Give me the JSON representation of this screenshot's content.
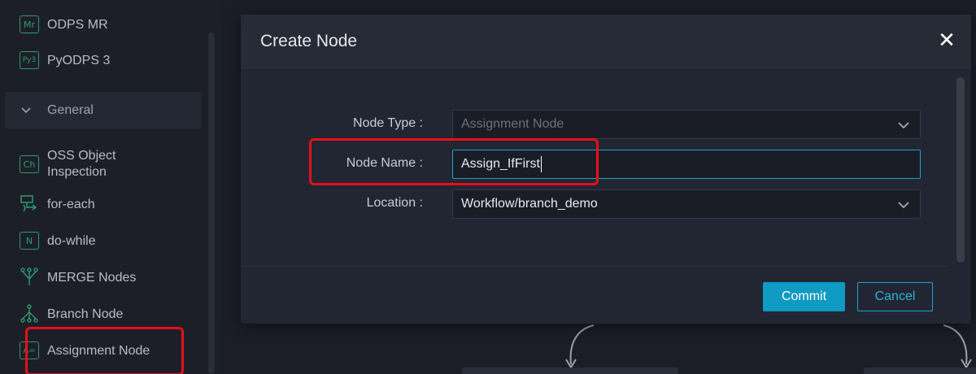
{
  "sidebar": {
    "items_top": [
      {
        "label": "ODPS MR",
        "icon": "mr-icon",
        "glyph": "Mr"
      },
      {
        "label": "PyODPS 3",
        "icon": "py3-icon",
        "glyph": "Py3"
      }
    ],
    "section": {
      "label": "General",
      "icon": "chevron-down-icon"
    },
    "items": [
      {
        "label_line1": "OSS Object",
        "label_line2": "Inspection",
        "icon": "ch-icon",
        "glyph": "Ch"
      },
      {
        "label": "for-each",
        "icon": "for-each-icon"
      },
      {
        "label": "do-while",
        "icon": "do-while-icon",
        "glyph": "N"
      },
      {
        "label": "MERGE Nodes",
        "icon": "merge-icon"
      },
      {
        "label": "Branch Node",
        "icon": "branch-icon"
      },
      {
        "label": "Assignment Node",
        "icon": "assignment-icon",
        "glyph": "A="
      }
    ]
  },
  "modal": {
    "title": "Create Node",
    "close_icon": "close-icon",
    "fields": {
      "node_type": {
        "label": "Node Type :",
        "value": "Assignment Node"
      },
      "node_name": {
        "label": "Node Name :",
        "value": "Assign_IfFirst"
      },
      "location": {
        "label": "Location :",
        "value": "Workflow/branch_demo"
      }
    },
    "buttons": {
      "commit": "Commit",
      "cancel": "Cancel"
    }
  },
  "colors": {
    "accent": "#0e9ac2",
    "annotation": "#e5101b",
    "icon_green": "#2e9a72"
  }
}
